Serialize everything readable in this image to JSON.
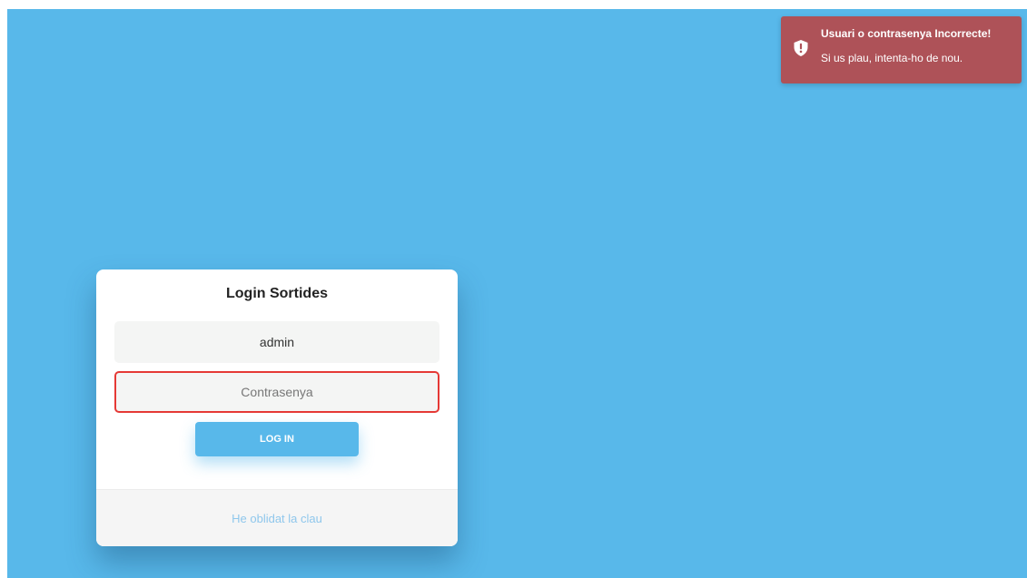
{
  "login": {
    "title": "Login Sortides",
    "username_value": "admin",
    "password_value": "",
    "password_placeholder": "Contrasenya",
    "login_button": "LOG IN",
    "forgot_link": "He oblidat la clau"
  },
  "toast": {
    "icon": "shield-alert-icon",
    "title": "Usuari o contrasenya Incorrecte!",
    "message": "Si us plau, intenta-ho de nou."
  },
  "colors": {
    "background": "#58b8ea",
    "toast_background": "#ae5258",
    "error_border": "#e53935",
    "link": "#8fc7ec"
  }
}
